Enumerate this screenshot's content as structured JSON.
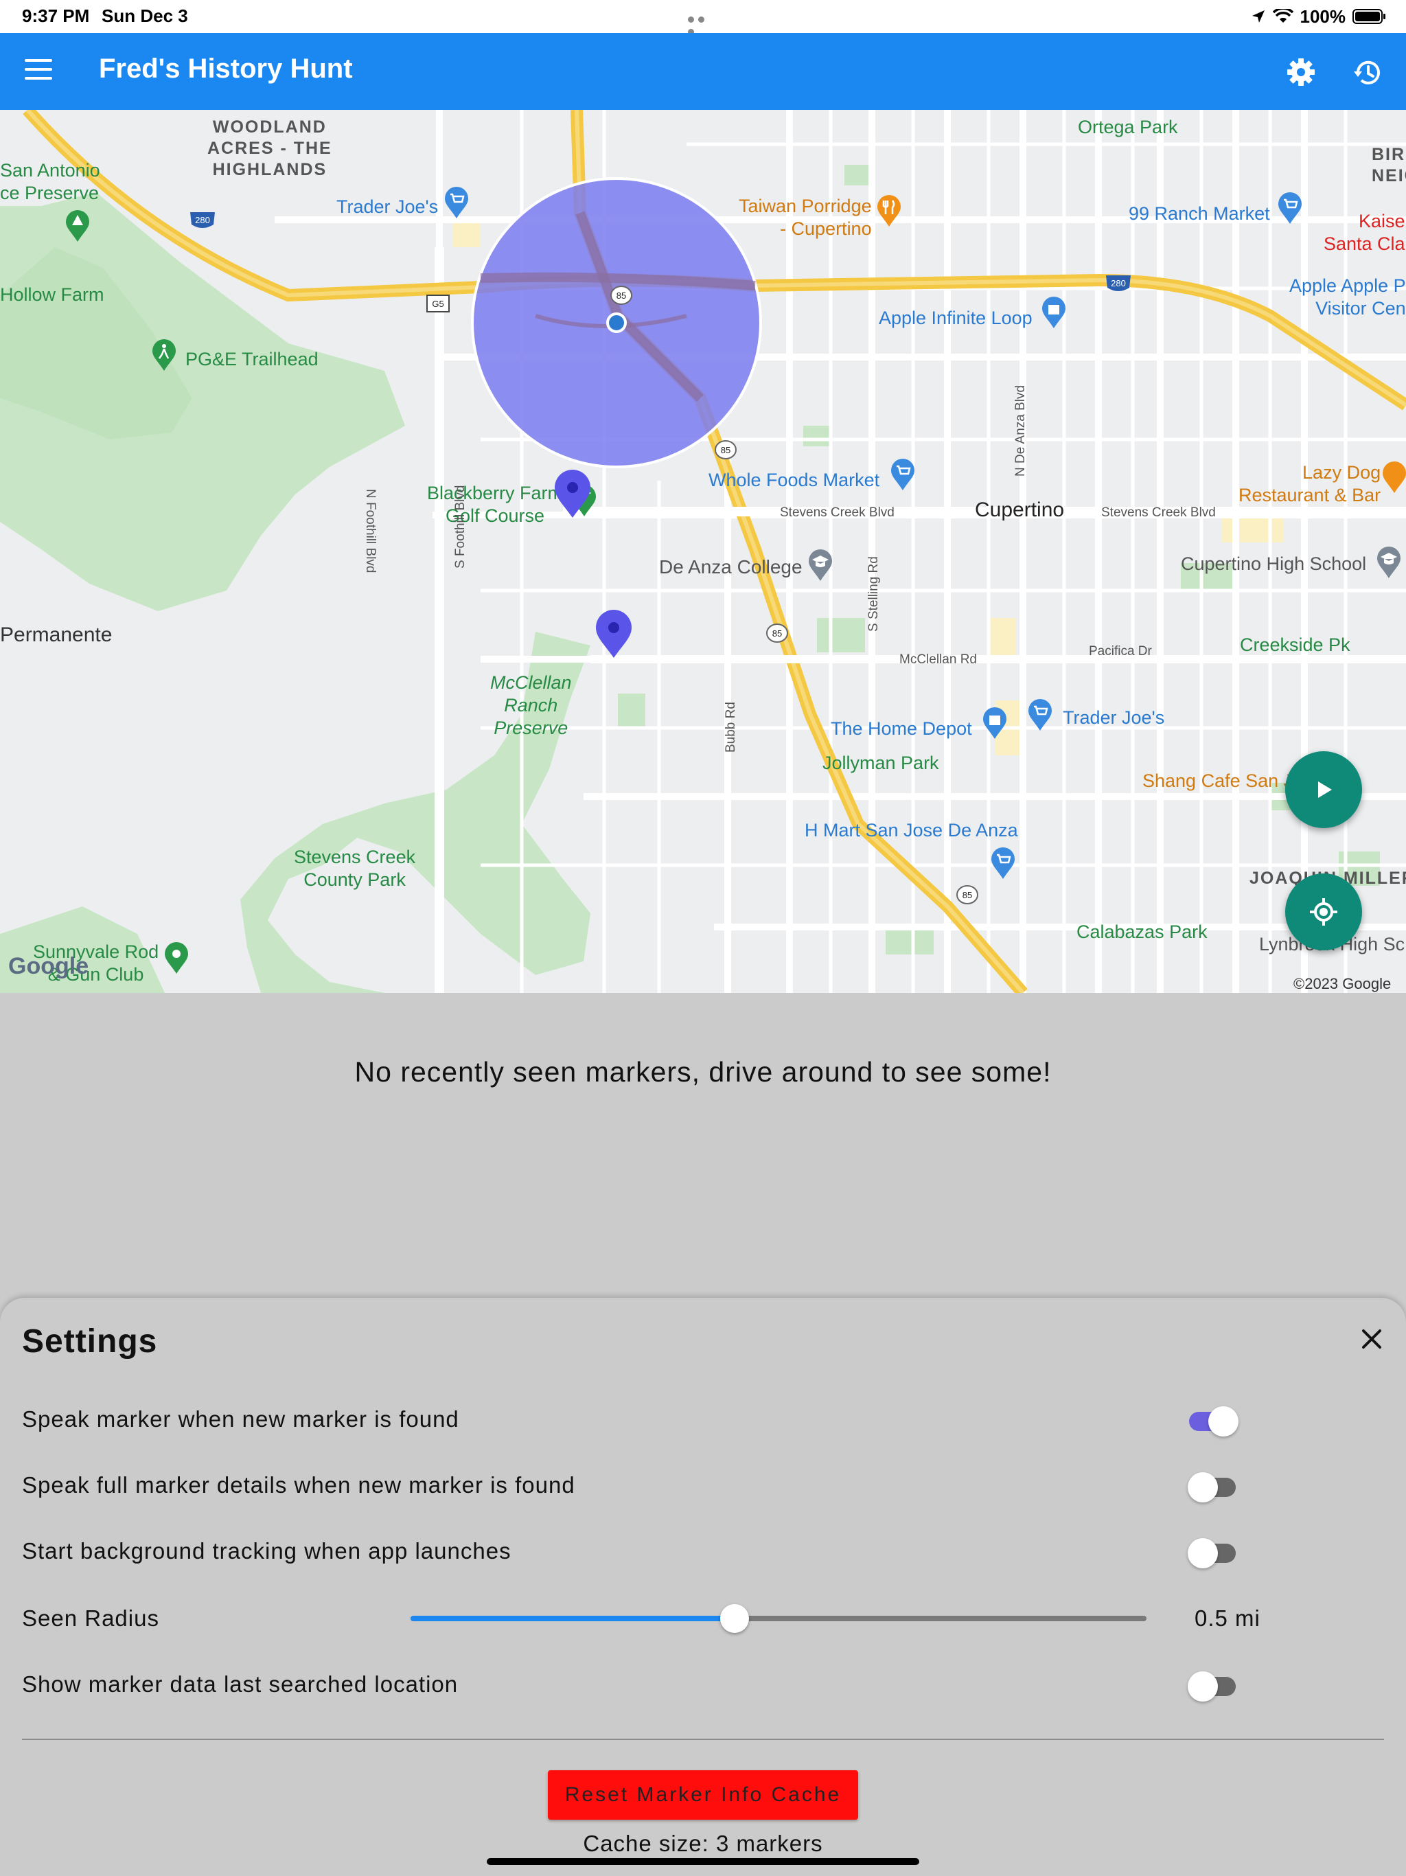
{
  "status_bar": {
    "time": "9:37 PM",
    "date": "Sun Dec 3",
    "battery": "100%"
  },
  "app_bar": {
    "title": "Fred's History Hunt",
    "background": "#1a88f0",
    "icons": [
      "menu-icon",
      "gear-icon",
      "history-icon"
    ]
  },
  "map": {
    "labels": {
      "woodland": "WOODLAND\nACRES - THE\nHIGHLANDS",
      "san_antonio": "San Antonio\nce Preserve",
      "hollow_farm": "Hollow Farm",
      "trader_joes_1": "Trader Joe's",
      "taiwan_porridge": "Taiwan Porridge\n- Cupertino",
      "ortega_park": "Ortega Park",
      "ranch_market": "99 Ranch Market",
      "birn": "BIR\nNEIG",
      "kaiser": "Kaise\nSanta Cla",
      "apple_park": "Apple Apple P\nVisitor Cen",
      "apple_infinite": "Apple Infinite Loop",
      "pge_trailhead": "PG&E Trailhead",
      "whole_foods": "Whole Foods Market",
      "lazy_dog": "Lazy Dog\nRestaurant & Bar",
      "blackberry_farm": "Blackberry Farm\nGolf Course",
      "stevens_creek_blvd_1": "Stevens Creek Blvd",
      "cupertino": "Cupertino",
      "stevens_creek_blvd_2": "Stevens Creek Blvd",
      "de_anza": "De Anza College",
      "cupertino_hs": "Cupertino High School",
      "permanente": "Permanente",
      "mcclellan_rd": "McClellan Rd",
      "pacifica_dr": "Pacifica Dr",
      "creekside": "Creekside Pk",
      "mcclellan_ranch": "McClellan\nRanch\nPreserve",
      "home_depot": "The Home Depot",
      "trader_joes_2": "Trader Joe's",
      "jollyman": "Jollyman Park",
      "shang_cafe": "Shang Cafe San J",
      "h_mart": "H Mart San Jose De Anza",
      "stevens_creek_park": "Stevens Creek\nCounty Park",
      "joaquin_miller": "JOAQUIN MILLER",
      "calabazas": "Calabazas Park",
      "lynbrook": "Lynbrook High Sc",
      "sunnyvale_rod": "Sunnyvale Rod\n& Gun Club",
      "n_foothill": "N Foothill Blvd",
      "s_foothill": "S Foothill Blvd",
      "n_de_anza": "N De Anza Blvd",
      "s_stelling": "S Stelling Rd",
      "bubb_rd": "Bubb Rd",
      "google": "Google",
      "copyright": "©2023 Google",
      "shield_280a": "280",
      "shield_280b": "280",
      "shield_85a": "85",
      "shield_85b": "85",
      "shield_85c": "85",
      "shield_85d": "85",
      "shield_g5": "G5"
    },
    "seen_radius_color": "#7b7bf0",
    "marker_color": "#5a55e8"
  },
  "recent": {
    "empty_message": "No recently seen markers, drive around to see some!"
  },
  "settings": {
    "title": "Settings",
    "rows": [
      {
        "label": "Speak marker when new marker is found",
        "enabled": true
      },
      {
        "label": "Speak full marker details when new marker is found",
        "enabled": false
      },
      {
        "label": "Start background tracking when app launches",
        "enabled": false
      },
      {
        "label": "Show marker data last searched location",
        "enabled": false
      }
    ],
    "seen_radius": {
      "label": "Seen Radius",
      "value_text": "0.5 mi",
      "fraction": 0.44
    },
    "reset_button": "Reset Marker Info Cache",
    "cache_size": "Cache size: 3 markers"
  }
}
